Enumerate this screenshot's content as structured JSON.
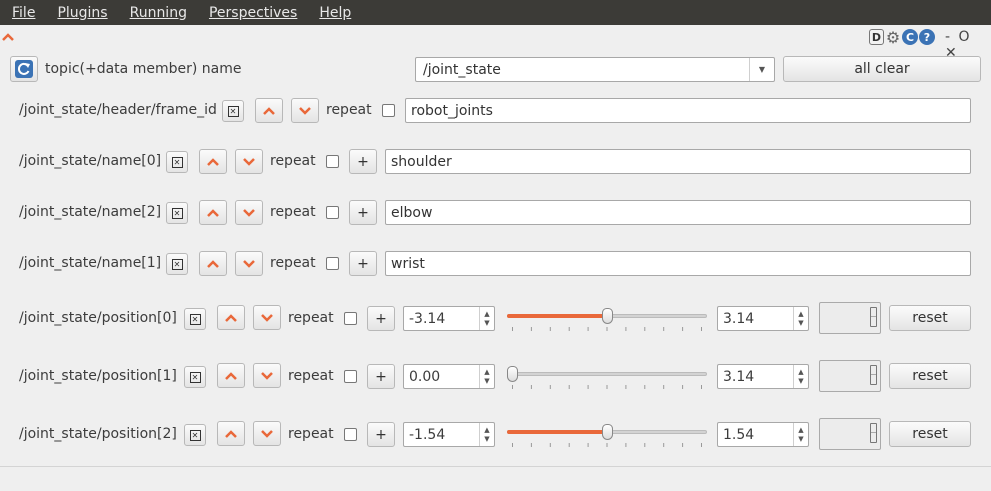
{
  "menu": [
    "File",
    "Plugins",
    "Running",
    "Perspectives",
    "Help"
  ],
  "dock": {
    "icons": [
      "D",
      "⚙",
      "C",
      "?"
    ],
    "window_controls": "- O ✕"
  },
  "toolbar": {
    "label": "topic(+data member) name",
    "topic_value": "/joint_state",
    "all_clear_label": "all clear"
  },
  "rows": [
    {
      "name": "/joint_state/header/frame_id",
      "repeat": "repeat",
      "value": "robot_joints"
    },
    {
      "name": "/joint_state/name[0]",
      "repeat": "repeat",
      "plus": "+",
      "value": "shoulder"
    },
    {
      "name": "/joint_state/name[2]",
      "repeat": "repeat",
      "plus": "+",
      "value": "elbow"
    },
    {
      "name": "/joint_state/name[1]",
      "repeat": "repeat",
      "plus": "+",
      "value": "wrist"
    },
    {
      "name": "/joint_state/position[0]",
      "repeat": "repeat",
      "plus": "+",
      "min": "-3.14",
      "max": "3.14",
      "slider_fraction": 0.5,
      "reset": "reset"
    },
    {
      "name": "/joint_state/position[1]",
      "repeat": "repeat",
      "plus": "+",
      "min": "0.00",
      "max": "3.14",
      "slider_fraction": 0.0,
      "reset": "reset"
    },
    {
      "name": "/joint_state/position[2]",
      "repeat": "repeat",
      "plus": "+",
      "min": "-1.54",
      "max": "1.54",
      "slider_fraction": 0.5,
      "reset": "reset"
    }
  ],
  "icons": {
    "remove": "x-box-icon",
    "up": "chevron-up-icon",
    "down": "chevron-down-icon",
    "refresh": "refresh-icon"
  },
  "colors": {
    "accent": "#e9683a",
    "refresh_blue": "#3b73b5",
    "menubar": "#3c3b37"
  }
}
